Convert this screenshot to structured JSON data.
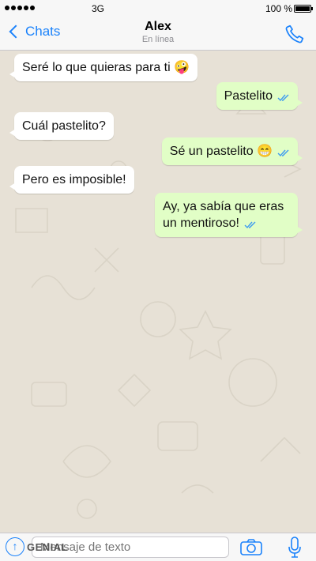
{
  "status_bar": {
    "carrier": "3G",
    "battery": "100 %"
  },
  "nav": {
    "back_label": "Chats",
    "contact_name": "Alex",
    "contact_status": "En línea"
  },
  "messages": [
    {
      "text": "Seré lo que quieras para ti 🤪",
      "direction": "incoming"
    },
    {
      "text": "Pastelito",
      "direction": "outgoing"
    },
    {
      "text": "Cuál pastelito?",
      "direction": "incoming"
    },
    {
      "text": "Sé un pastelito 😁",
      "direction": "outgoing"
    },
    {
      "text": "Pero es imposible!",
      "direction": "incoming"
    },
    {
      "text": "Ay, ya sabía que eras un mentiroso!",
      "direction": "outgoing"
    }
  ],
  "input": {
    "placeholder": "Mensaje de texto",
    "watermark": "GENIAL"
  },
  "colors": {
    "accent": "#1a82fb",
    "outgoing_bubble": "#e1fec6",
    "incoming_bubble": "#ffffff",
    "read_ticks": "#3d9bf0"
  }
}
